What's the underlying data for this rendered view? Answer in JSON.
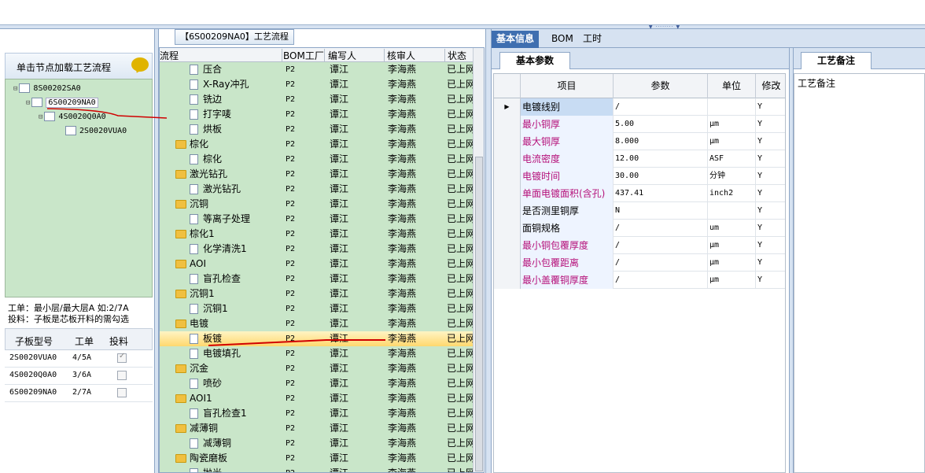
{
  "app": {
    "middle_title": "【6S00209NA0】工艺流程"
  },
  "left": {
    "load_button": "单击节点加载工艺流程",
    "tree": [
      {
        "label": "8S00202SA0",
        "level": 0
      },
      {
        "label": "6S00209NA0",
        "level": 1,
        "selected": true
      },
      {
        "label": "4S0020Q0A0",
        "level": 2
      },
      {
        "label": "2S0020VUA0",
        "level": 3
      }
    ],
    "tip_line1": "工单：最小层/最大层A 如:2/7A",
    "tip_line2": "投料：子板是芯板开料的需勾选",
    "sub_headers": [
      "子板型号",
      "工单",
      "投料"
    ],
    "sub_rows": [
      {
        "model": "2S0020VUA0",
        "order": "4/5A",
        "feed": true
      },
      {
        "model": "4S0020Q0A0",
        "order": "3/6A",
        "feed": false
      },
      {
        "model": "6S00209NA0",
        "order": "2/7A",
        "feed": false
      }
    ]
  },
  "middle": {
    "headers": [
      "流程",
      "BOM工厂",
      "编写人",
      "核审人",
      "状态"
    ],
    "rows": [
      {
        "name": "压合",
        "type": "doc",
        "bom": "P2",
        "writer": "谭江",
        "reviewer": "李海燕",
        "status": "已上网"
      },
      {
        "name": "X-Ray冲孔",
        "type": "doc",
        "bom": "P2",
        "writer": "谭江",
        "reviewer": "李海燕",
        "status": "已上网"
      },
      {
        "name": "铣边",
        "type": "doc",
        "bom": "P2",
        "writer": "谭江",
        "reviewer": "李海燕",
        "status": "已上网"
      },
      {
        "name": "打字唛",
        "type": "doc",
        "bom": "P2",
        "writer": "谭江",
        "reviewer": "李海燕",
        "status": "已上网"
      },
      {
        "name": "烘板",
        "type": "doc",
        "bom": "P2",
        "writer": "谭江",
        "reviewer": "李海燕",
        "status": "已上网"
      },
      {
        "name": "棕化",
        "type": "folder",
        "bom": "P2",
        "writer": "谭江",
        "reviewer": "李海燕",
        "status": "已上网"
      },
      {
        "name": "棕化",
        "type": "doc",
        "bom": "P2",
        "writer": "谭江",
        "reviewer": "李海燕",
        "status": "已上网"
      },
      {
        "name": "激光钻孔",
        "type": "folder",
        "bom": "P2",
        "writer": "谭江",
        "reviewer": "李海燕",
        "status": "已上网"
      },
      {
        "name": "激光钻孔",
        "type": "doc",
        "bom": "P2",
        "writer": "谭江",
        "reviewer": "李海燕",
        "status": "已上网"
      },
      {
        "name": "沉铜",
        "type": "folder",
        "bom": "P2",
        "writer": "谭江",
        "reviewer": "李海燕",
        "status": "已上网"
      },
      {
        "name": "等离子处理",
        "type": "doc",
        "bom": "P2",
        "writer": "谭江",
        "reviewer": "李海燕",
        "status": "已上网"
      },
      {
        "name": "棕化1",
        "type": "folder",
        "bom": "P2",
        "writer": "谭江",
        "reviewer": "李海燕",
        "status": "已上网"
      },
      {
        "name": "化学清洗1",
        "type": "doc",
        "bom": "P2",
        "writer": "谭江",
        "reviewer": "李海燕",
        "status": "已上网"
      },
      {
        "name": "AOI",
        "type": "folder",
        "bom": "P2",
        "writer": "谭江",
        "reviewer": "李海燕",
        "status": "已上网"
      },
      {
        "name": "盲孔检查",
        "type": "doc",
        "bom": "P2",
        "writer": "谭江",
        "reviewer": "李海燕",
        "status": "已上网"
      },
      {
        "name": "沉铜1",
        "type": "folder",
        "bom": "P2",
        "writer": "谭江",
        "reviewer": "李海燕",
        "status": "已上网"
      },
      {
        "name": "沉铜1",
        "type": "doc",
        "bom": "P2",
        "writer": "谭江",
        "reviewer": "李海燕",
        "status": "已上网"
      },
      {
        "name": "电镀",
        "type": "folder",
        "bom": "P2",
        "writer": "谭江",
        "reviewer": "李海燕",
        "status": "已上网"
      },
      {
        "name": "板镀",
        "type": "doc",
        "bom": "P2",
        "writer": "谭江",
        "reviewer": "李海燕",
        "status": "已上网",
        "highlight": true
      },
      {
        "name": "电镀填孔",
        "type": "doc",
        "bom": "P2",
        "writer": "谭江",
        "reviewer": "李海燕",
        "status": "已上网"
      },
      {
        "name": "沉金",
        "type": "folder",
        "bom": "P2",
        "writer": "谭江",
        "reviewer": "李海燕",
        "status": "已上网"
      },
      {
        "name": "喷砂",
        "type": "doc",
        "bom": "P2",
        "writer": "谭江",
        "reviewer": "李海燕",
        "status": "已上网"
      },
      {
        "name": "AOI1",
        "type": "folder",
        "bom": "P2",
        "writer": "谭江",
        "reviewer": "李海燕",
        "status": "已上网"
      },
      {
        "name": "盲孔检查1",
        "type": "doc",
        "bom": "P2",
        "writer": "谭江",
        "reviewer": "李海燕",
        "status": "已上网"
      },
      {
        "name": "减薄铜",
        "type": "folder",
        "bom": "P2",
        "writer": "谭江",
        "reviewer": "李海燕",
        "status": "已上网"
      },
      {
        "name": "减薄铜",
        "type": "doc",
        "bom": "P2",
        "writer": "谭江",
        "reviewer": "李海燕",
        "status": "已上网"
      },
      {
        "name": "陶瓷磨板",
        "type": "folder",
        "bom": "P2",
        "writer": "谭江",
        "reviewer": "李海燕",
        "status": "已上网"
      },
      {
        "name": "抛光",
        "type": "doc",
        "bom": "P2",
        "writer": "谭江",
        "reviewer": "李海燕",
        "status": "已上网"
      }
    ]
  },
  "right": {
    "tabs": [
      "基本信息",
      "BOM",
      "工时"
    ],
    "subtab": "基本参数",
    "notes_tab": "工艺备注",
    "notes_label": "工艺备注",
    "grid_headers": [
      "项目",
      "参数",
      "单位",
      "修改"
    ],
    "grid_rows": [
      {
        "item": "电镀线别",
        "param": "/",
        "unit": "",
        "mod": "Y",
        "pink": false,
        "current": true
      },
      {
        "item": "最小铜厚",
        "param": "5.00",
        "unit": "μm",
        "mod": "Y",
        "pink": true
      },
      {
        "item": "最大铜厚",
        "param": "8.000",
        "unit": "μm",
        "mod": "Y",
        "pink": true
      },
      {
        "item": "电流密度",
        "param": "12.00",
        "unit": "ASF",
        "mod": "Y",
        "pink": true
      },
      {
        "item": "电镀时间",
        "param": "30.00",
        "unit": "分钟",
        "mod": "Y",
        "pink": true
      },
      {
        "item": "单面电镀面积(含孔)",
        "param": "437.41",
        "unit": "inch2",
        "mod": "Y",
        "pink": true
      },
      {
        "item": "是否测里铜厚",
        "param": "N",
        "unit": "",
        "mod": "Y",
        "pink": false
      },
      {
        "item": "面铜规格",
        "param": "/",
        "unit": "um",
        "mod": "Y",
        "pink": false
      },
      {
        "item": "最小铜包覆厚度",
        "param": "/",
        "unit": "μm",
        "mod": "Y",
        "pink": true
      },
      {
        "item": "最小包覆距离",
        "param": "/",
        "unit": "μm",
        "mod": "Y",
        "pink": true
      },
      {
        "item": "最小盖覆铜厚度",
        "param": "/",
        "unit": "μm",
        "mod": "Y",
        "pink": true
      }
    ]
  }
}
